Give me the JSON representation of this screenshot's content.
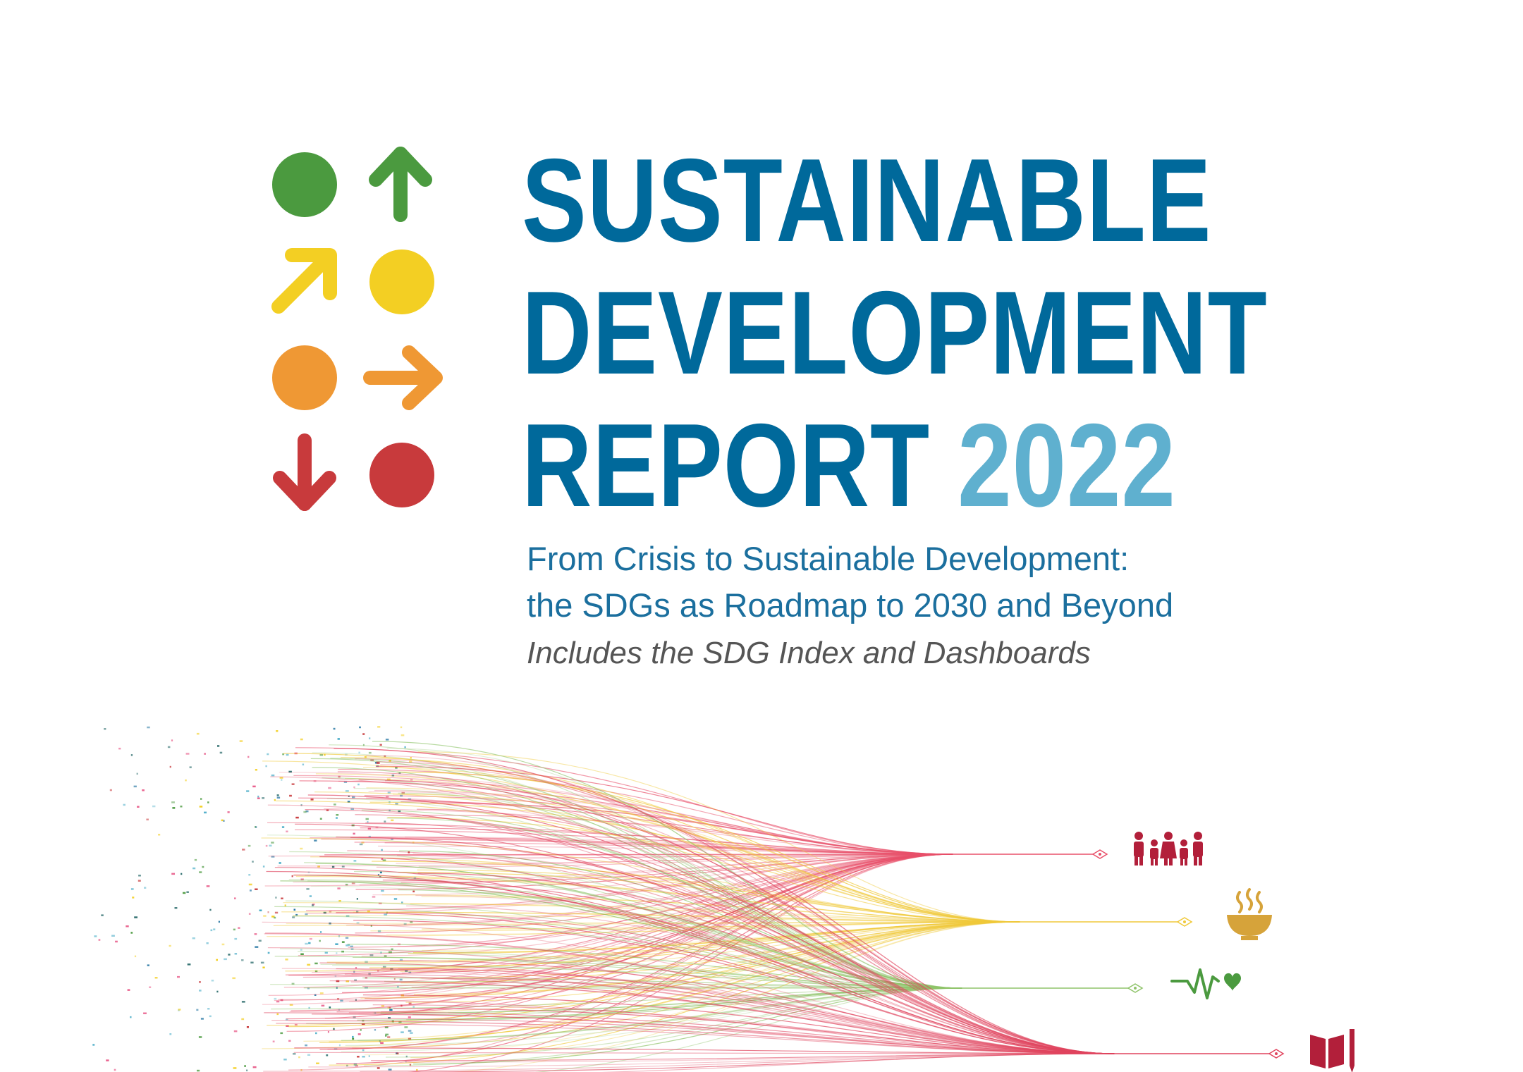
{
  "title": {
    "line1": "SUSTAINABLE",
    "line2": "DEVELOPMENT",
    "line3_word": "REPORT",
    "line3_year": "2022"
  },
  "subtitle": {
    "line1": "From Crisis to Sustainable Development:",
    "line2": "the SDGs as Roadmap to 2030 and Beyond"
  },
  "includes": "Includes the SDG Index and Dashboards",
  "colors": {
    "title": "#00699b",
    "year": "#5fb0cf",
    "green": "#4b9a3f",
    "yellow": "#f3cf23",
    "orange": "#ef9834",
    "red": "#c83a3c",
    "gold": "#d6a33a",
    "maroon": "#b21f3a"
  },
  "logo": {
    "items": [
      {
        "shape": "circle",
        "color": "green"
      },
      {
        "shape": "arrow-up",
        "color": "green"
      },
      {
        "shape": "arrow-up-right",
        "color": "yellow"
      },
      {
        "shape": "circle",
        "color": "yellow"
      },
      {
        "shape": "circle",
        "color": "orange"
      },
      {
        "shape": "arrow-right",
        "color": "orange"
      },
      {
        "shape": "arrow-down",
        "color": "red"
      },
      {
        "shape": "circle",
        "color": "red"
      }
    ]
  },
  "flow": {
    "icons": [
      "people-icon",
      "bowl-icon",
      "heartbeat-icon",
      "book-icon"
    ]
  }
}
